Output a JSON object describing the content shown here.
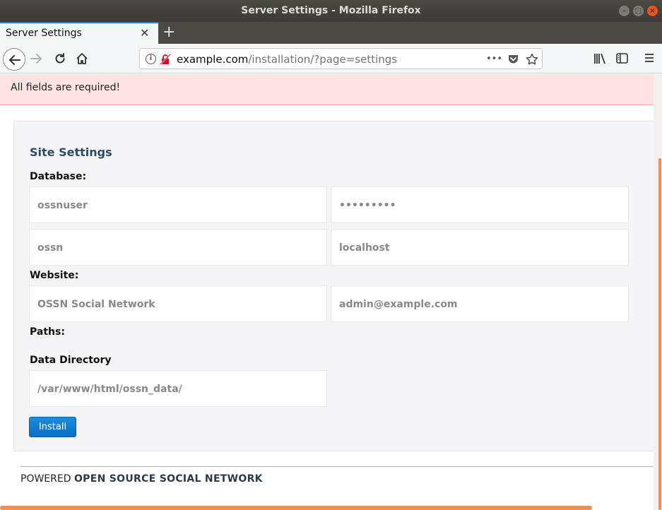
{
  "window": {
    "title": "Server Settings - Mozilla Firefox",
    "min_glyph": "–",
    "max_glyph": "□",
    "close_glyph": "×"
  },
  "tabs": [
    {
      "label": "Server Settings",
      "close_glyph": "✕"
    }
  ],
  "newtab_glyph": "+",
  "urlbar": {
    "host": "example.com",
    "path": "/installation/?page=settings",
    "more_glyph": "•••"
  },
  "alert": {
    "text": "All fields are required!"
  },
  "form": {
    "title": "Site Settings",
    "database_label": "Database:",
    "website_label": "Website:",
    "paths_label": "Paths:",
    "data_dir_label": "Data Directory",
    "db_user": "ossnuser",
    "db_password": "•••••••••",
    "db_name": "ossn",
    "db_host": "localhost",
    "site_name": "OSSN Social Network",
    "admin_email": "admin@example.com",
    "data_dir": "/var/www/html/ossn_data/",
    "install_label": "Install"
  },
  "footer": {
    "prefix": "POWERED",
    "link": "OPEN SOURCE SOCIAL NETWORK"
  },
  "colors": {
    "accent": "#0a84ff",
    "alert_bg": "#fde2e2",
    "button": "#1a8de0",
    "ubuntu_orange": "#e95420"
  }
}
